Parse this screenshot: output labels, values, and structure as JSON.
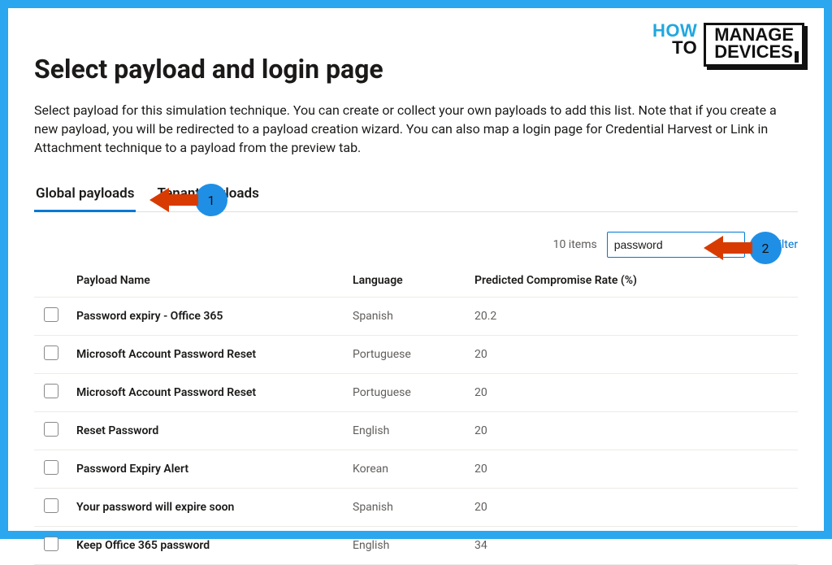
{
  "logo": {
    "how": "HOW",
    "to": "TO",
    "manage": "MANAGE",
    "devices": "DEVICES"
  },
  "page": {
    "title": "Select payload and login page",
    "description": "Select payload for this simulation technique. You can create or collect your own payloads to add this list. Note that if you create a new payload, you will be redirected to a payload creation wizard. You can also map a login page for Credential Harvest or Link in Attachment technique to a payload from the preview tab."
  },
  "tabs": {
    "global": "Global payloads",
    "tenant": "Tenant payloads"
  },
  "toolbar": {
    "item_count": "10 items",
    "search_value": "password",
    "filter_label": "Filter"
  },
  "callouts": {
    "one": "1",
    "two": "2"
  },
  "table": {
    "headers": {
      "name": "Payload Name",
      "language": "Language",
      "rate": "Predicted Compromise Rate (%)"
    },
    "rows": [
      {
        "name": "Password expiry - Office 365",
        "language": "Spanish",
        "rate": "20.2"
      },
      {
        "name": "Microsoft Account Password Reset",
        "language": "Portuguese",
        "rate": "20"
      },
      {
        "name": "Microsoft Account Password Reset",
        "language": "Portuguese",
        "rate": "20"
      },
      {
        "name": "Reset Password",
        "language": "English",
        "rate": "20"
      },
      {
        "name": "Password Expiry Alert",
        "language": "Korean",
        "rate": "20"
      },
      {
        "name": "Your password will expire soon",
        "language": "Spanish",
        "rate": "20"
      },
      {
        "name": "Keep Office 365 password",
        "language": "English",
        "rate": "34"
      }
    ]
  }
}
